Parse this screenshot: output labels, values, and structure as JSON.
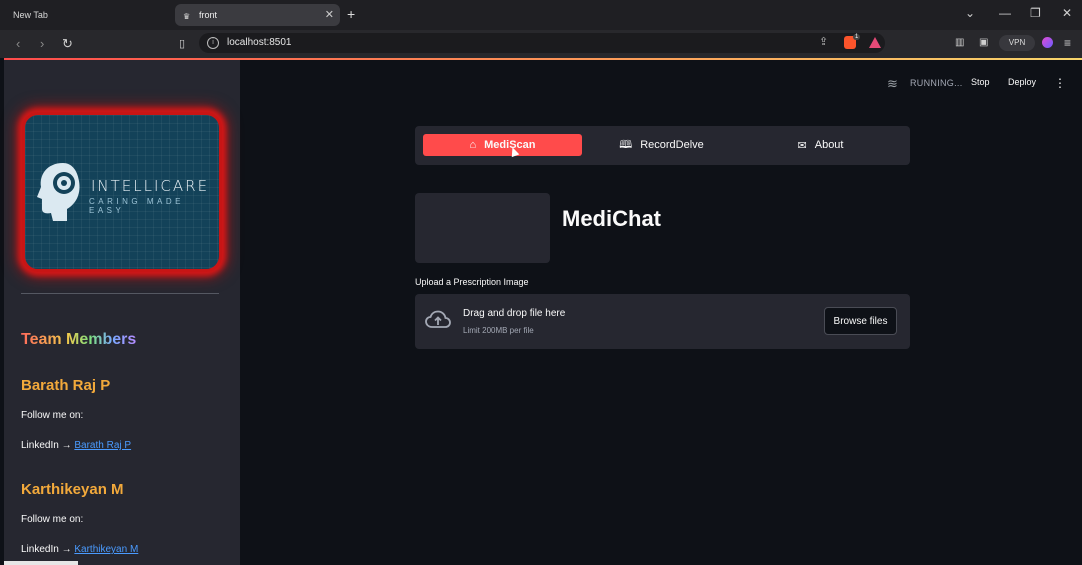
{
  "browser": {
    "tabs": [
      {
        "title": "New Tab",
        "active": false
      },
      {
        "title": "front",
        "active": true
      }
    ],
    "url": "localhost:8501",
    "vpn_label": "VPN",
    "brave_badge": "1"
  },
  "header": {
    "status": "RUNNING...",
    "stop_label": "Stop",
    "deploy_label": "Deploy"
  },
  "sidebar": {
    "logo": {
      "title": "INTELLICARE",
      "subtitle": "CARING MADE EASY"
    },
    "team_title": "Team Members",
    "members": [
      {
        "name": "Barath Raj P",
        "follow": "Follow me on:",
        "linkedin_prefix": "LinkedIn →",
        "linkedin_link": "Barath Raj P"
      },
      {
        "name": "Karthikeyan M",
        "follow": "Follow me on:",
        "linkedin_prefix": "LinkedIn →",
        "linkedin_link": "Karthikeyan M"
      }
    ]
  },
  "nav": {
    "items": [
      {
        "label": "MediScan",
        "icon": "house-icon",
        "active": true
      },
      {
        "label": "RecordDelve",
        "icon": "book-icon",
        "active": false
      },
      {
        "label": "About",
        "icon": "envelope-icon",
        "active": false
      }
    ],
    "active_color": "#ff4b4b"
  },
  "main": {
    "title": "MediChat",
    "upload_label": "Upload a Prescription Image",
    "dropzone": {
      "title": "Drag and drop file here",
      "limit": "Limit 200MB per file",
      "browse_label": "Browse files"
    }
  },
  "colors": {
    "background": "#0e1117",
    "sidebar": "#262730",
    "accent": "#ff4b4b",
    "member_name": "#f2a93b",
    "link": "#4a9bff"
  }
}
